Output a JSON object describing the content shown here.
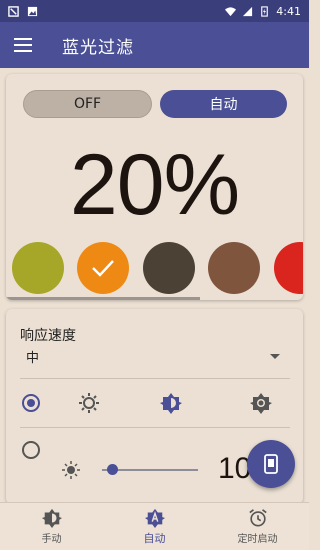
{
  "status_bar": {
    "time": "4:41",
    "icons": [
      "notification-icon",
      "image-icon",
      "wifi-icon",
      "signal-icon",
      "battery-icon"
    ]
  },
  "app_bar": {
    "title": "蓝光过滤",
    "menu_icon": "menu-icon"
  },
  "filter_card": {
    "mode_off_label": "OFF",
    "mode_auto_label": "自动",
    "selected_mode": "自动",
    "percent_text": "20%",
    "swatches": [
      {
        "color": "#a6a629",
        "selected": false
      },
      {
        "color": "#ee8a14",
        "selected": true
      },
      {
        "color": "#4c4135",
        "selected": false
      },
      {
        "color": "#80553d",
        "selected": false
      },
      {
        "color": "#d9251e",
        "selected": false
      }
    ]
  },
  "settings_card": {
    "speed_label": "响应速度",
    "speed_value": "中",
    "brightness_value": "10",
    "slider_fraction": 0.1
  },
  "bottom_nav": {
    "tabs": [
      {
        "label": "手动",
        "icon": "brightness-half-icon",
        "active": false
      },
      {
        "label": "自动",
        "icon": "auto-brightness-icon",
        "active": true
      },
      {
        "label": "定时启动",
        "icon": "alarm-clock-icon",
        "active": false
      }
    ]
  },
  "colors": {
    "accent": "#4a4f96",
    "statusbar": "#3a3f7c",
    "background": "#ece0d3"
  }
}
